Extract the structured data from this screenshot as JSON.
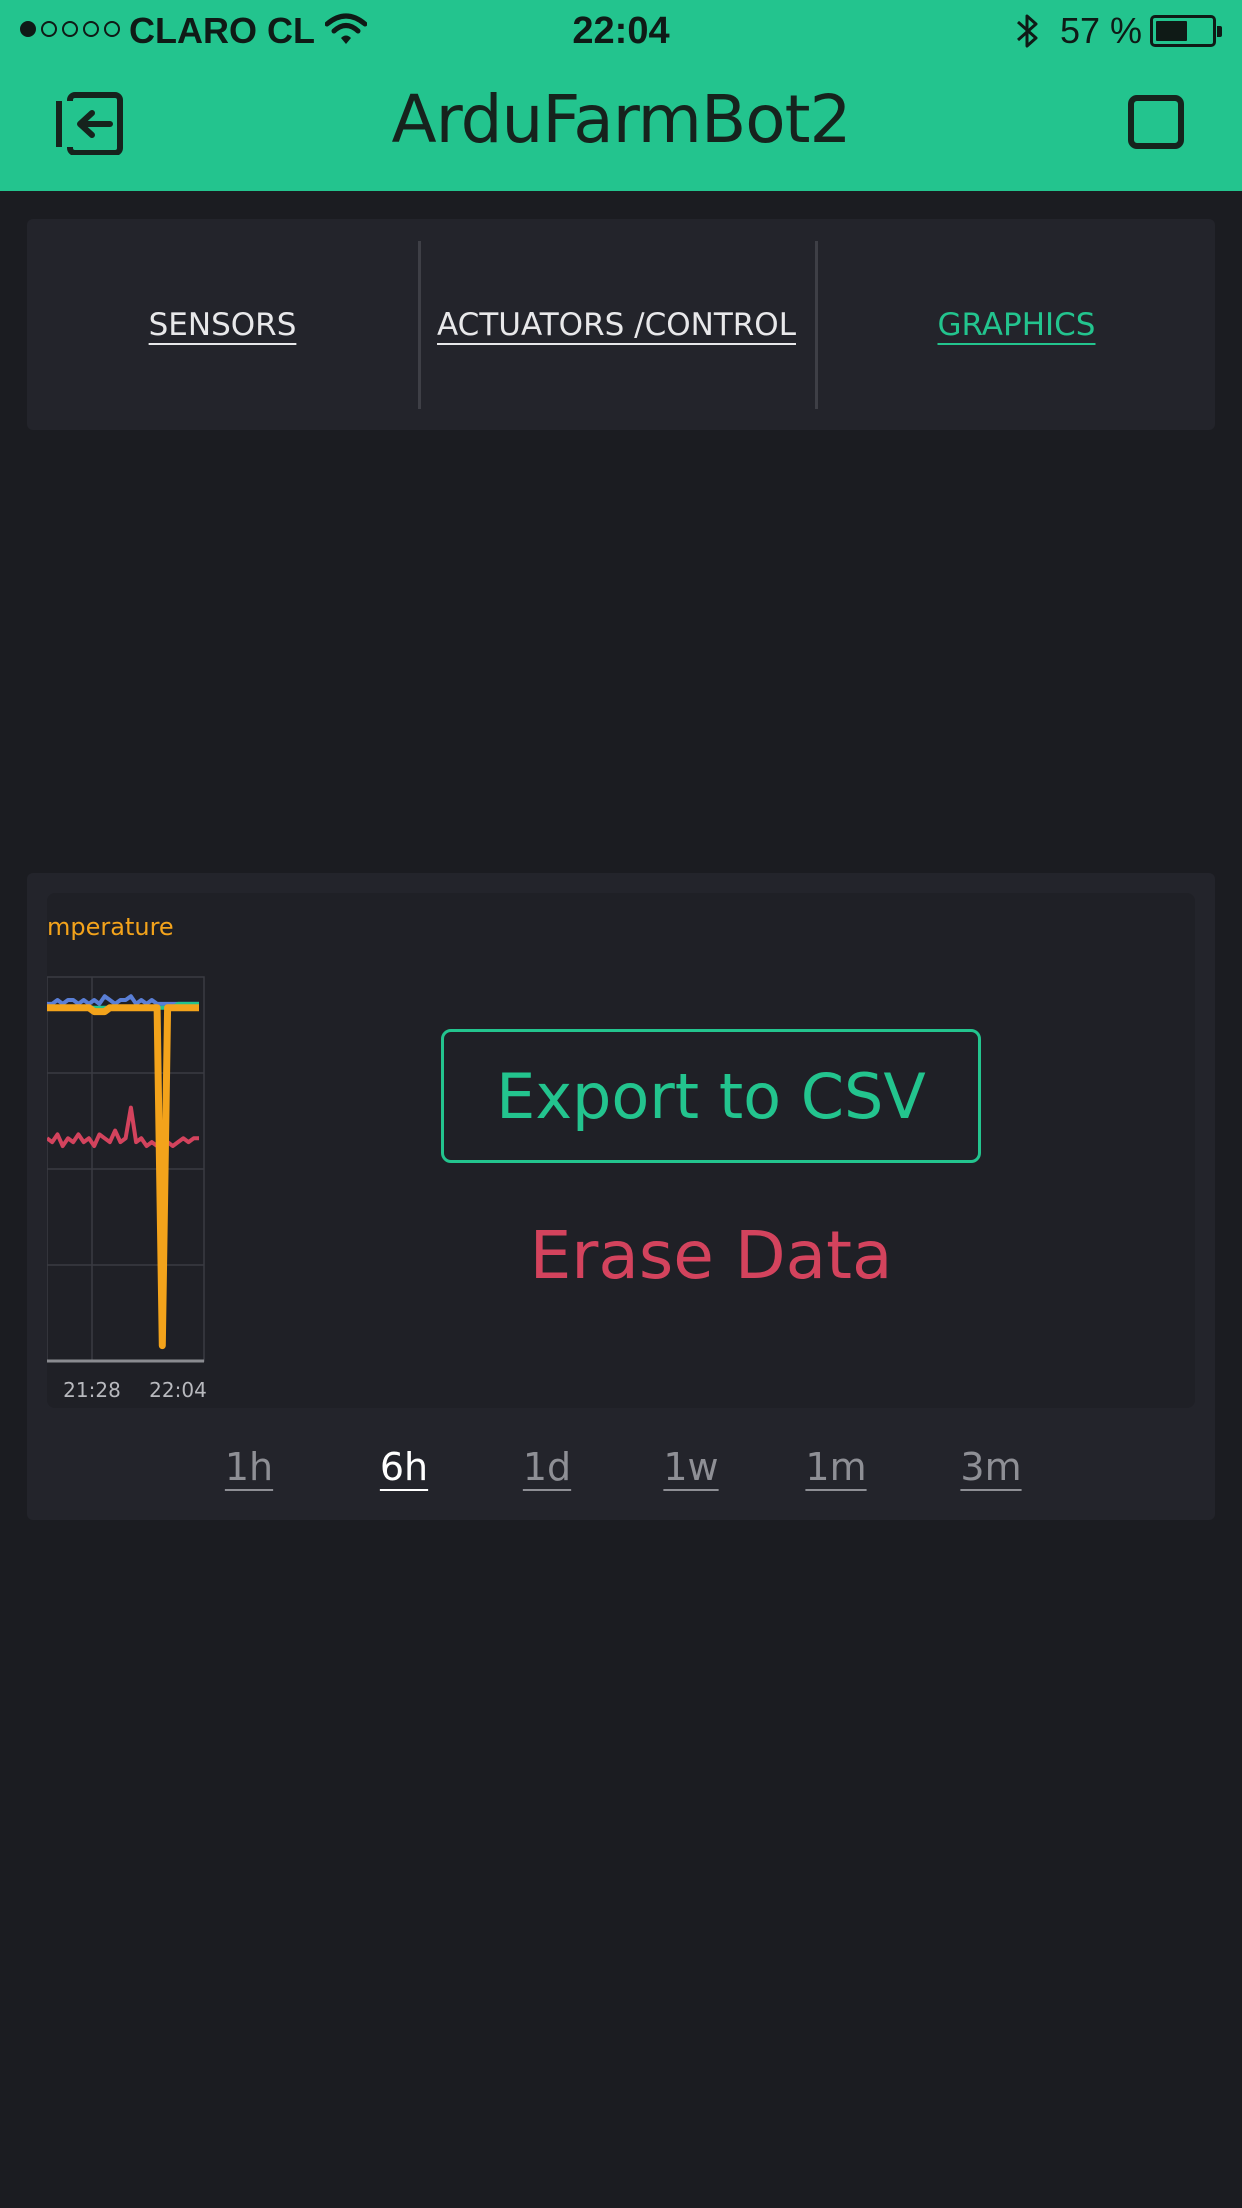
{
  "status_bar": {
    "carrier": "CLARO CL",
    "time": "22:04",
    "battery_pct": "57 %",
    "battery_level": 0.57,
    "signal_bars_filled": 1,
    "signal_bars_total": 5
  },
  "header": {
    "title": "ArduFarmBot2",
    "icons": [
      "back-icon",
      "stop-icon"
    ]
  },
  "tabs": [
    {
      "label": "SENSORS",
      "active": false
    },
    {
      "label": "ACTUATORS /CONTROL",
      "active": false
    },
    {
      "label": "GRAPHICS",
      "active": true
    }
  ],
  "chart": {
    "title_fragment": "mperature",
    "export_label": "Export to CSV",
    "erase_label": "Erase Data",
    "ranges": [
      {
        "label": "1h",
        "active": false
      },
      {
        "label": "6h",
        "active": true
      },
      {
        "label": "1d",
        "active": false
      },
      {
        "label": "1w",
        "active": false
      },
      {
        "label": "1m",
        "active": false
      },
      {
        "label": "3m",
        "active": false
      }
    ]
  },
  "colors": {
    "accent": "#23c48e",
    "danger": "#d3435d",
    "series_orange": "#f3a31b",
    "series_red": "#d3435d",
    "series_blue": "#5a7fd6",
    "series_green": "#23c48e",
    "background": "#1b1c21",
    "panel": "#23242b"
  },
  "chart_data": {
    "type": "line",
    "title": "mperature",
    "x": [
      "21:28",
      "22:04"
    ],
    "x_tick_labels": [
      "21:28",
      "22:04"
    ],
    "series": [
      {
        "color": "#f3a31b",
        "values": [
          0.92,
          0.92,
          0.92,
          0.92,
          0.92,
          0.92,
          0.92,
          0.92,
          0.92,
          0.91,
          0.91,
          0.91,
          0.92,
          0.92,
          0.92,
          0.92,
          0.92,
          0.92,
          0.92,
          0.92,
          0.92,
          0.92,
          0.04,
          0.92,
          0.92,
          0.92,
          0.92,
          0.92,
          0.92,
          0.92
        ]
      },
      {
        "color": "#d3435d",
        "values": [
          0.58,
          0.57,
          0.59,
          0.56,
          0.58,
          0.57,
          0.59,
          0.57,
          0.58,
          0.56,
          0.59,
          0.58,
          0.57,
          0.6,
          0.57,
          0.58,
          0.66,
          0.57,
          0.58,
          0.56,
          0.57,
          0.56,
          0.57,
          0.57,
          0.56,
          0.57,
          0.58,
          0.57,
          0.58,
          0.58
        ]
      },
      {
        "color": "#5a7fd6",
        "values": [
          0.93,
          0.93,
          0.94,
          0.93,
          0.94,
          0.94,
          0.93,
          0.94,
          0.93,
          0.94,
          0.93,
          0.95,
          0.94,
          0.93,
          0.94,
          0.94,
          0.95,
          0.93,
          0.94,
          0.93,
          0.94,
          0.93,
          0.93,
          0.93,
          0.93,
          0.93,
          0.93,
          0.93,
          0.93,
          0.93
        ]
      },
      {
        "color": "#23c48e",
        "values": [
          0.92,
          0.92,
          0.92,
          0.92,
          0.92,
          0.92,
          0.92,
          0.92,
          0.92,
          0.92,
          0.92,
          0.92,
          0.92,
          0.92,
          0.92,
          0.92,
          0.92,
          0.92,
          0.92,
          0.92,
          0.92,
          0.92,
          0.92,
          0.92,
          0.92,
          0.93,
          0.93,
          0.93,
          0.93,
          0.93
        ]
      }
    ],
    "grid": true
  }
}
